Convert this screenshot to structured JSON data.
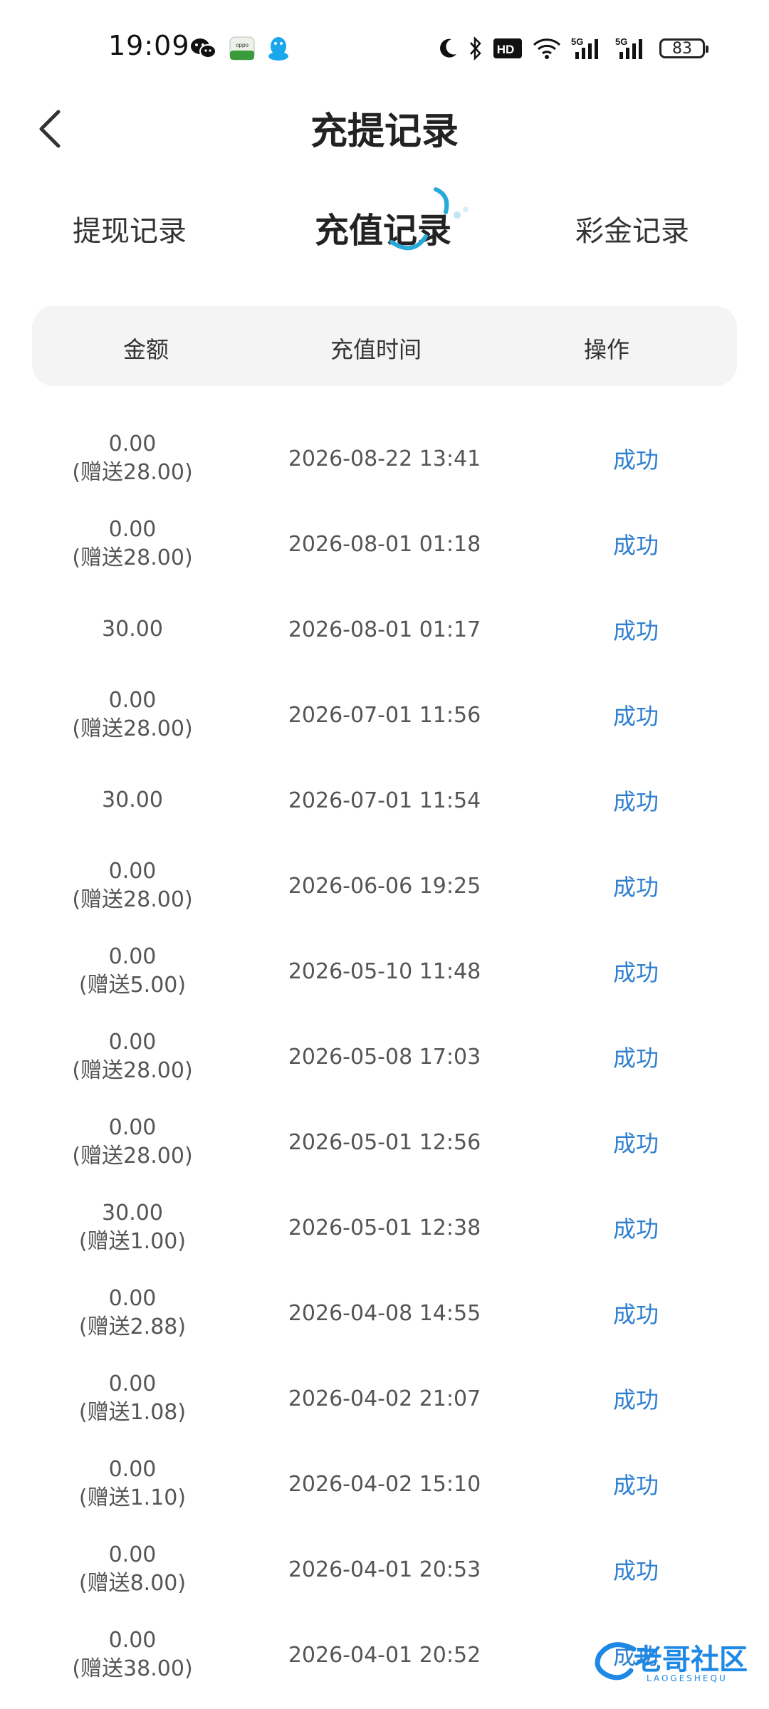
{
  "status_bar": {
    "time": "19:09",
    "hd_label": "HD",
    "net1": "5G",
    "net2": "5G",
    "battery": "83"
  },
  "header": {
    "title": "充提记录"
  },
  "tabs": [
    {
      "label": "提现记录"
    },
    {
      "label": "充值记录"
    },
    {
      "label": "彩金记录"
    }
  ],
  "active_tab": "充值记录",
  "table": {
    "columns": [
      "金额",
      "充值时间",
      "操作"
    ],
    "rows": [
      {
        "amount": "0.00",
        "bonus": "(赠送28.00)",
        "time": "2026-08-22 13:41",
        "status": "成功"
      },
      {
        "amount": "0.00",
        "bonus": "(赠送28.00)",
        "time": "2026-08-01 01:18",
        "status": "成功"
      },
      {
        "amount": "30.00",
        "bonus": "",
        "time": "2026-08-01 01:17",
        "status": "成功"
      },
      {
        "amount": "0.00",
        "bonus": "(赠送28.00)",
        "time": "2026-07-01 11:56",
        "status": "成功"
      },
      {
        "amount": "30.00",
        "bonus": "",
        "time": "2026-07-01 11:54",
        "status": "成功"
      },
      {
        "amount": "0.00",
        "bonus": "(赠送28.00)",
        "time": "2026-06-06 19:25",
        "status": "成功"
      },
      {
        "amount": "0.00",
        "bonus": "(赠送5.00)",
        "time": "2026-05-10 11:48",
        "status": "成功"
      },
      {
        "amount": "0.00",
        "bonus": "(赠送28.00)",
        "time": "2026-05-08 17:03",
        "status": "成功"
      },
      {
        "amount": "0.00",
        "bonus": "(赠送28.00)",
        "time": "2026-05-01 12:56",
        "status": "成功"
      },
      {
        "amount": "30.00",
        "bonus": "(赠送1.00)",
        "time": "2026-05-01 12:38",
        "status": "成功"
      },
      {
        "amount": "0.00",
        "bonus": "(赠送2.88)",
        "time": "2026-04-08 14:55",
        "status": "成功"
      },
      {
        "amount": "0.00",
        "bonus": "(赠送1.08)",
        "time": "2026-04-02 21:07",
        "status": "成功"
      },
      {
        "amount": "0.00",
        "bonus": "(赠送1.10)",
        "time": "2026-04-02 15:10",
        "status": "成功"
      },
      {
        "amount": "0.00",
        "bonus": "(赠送8.00)",
        "time": "2026-04-01 20:53",
        "status": "成功"
      },
      {
        "amount": "0.00",
        "bonus": "(赠送38.00)",
        "time": "2026-04-01 20:52",
        "status": "成功"
      }
    ]
  },
  "watermark": {
    "text": "老哥社区",
    "sub": "LAOGESHEQU"
  },
  "colors": {
    "status_blue": "#2f7fd0",
    "header_bg": "#f4f4f4",
    "indicator_blue": "#29a9d9"
  }
}
